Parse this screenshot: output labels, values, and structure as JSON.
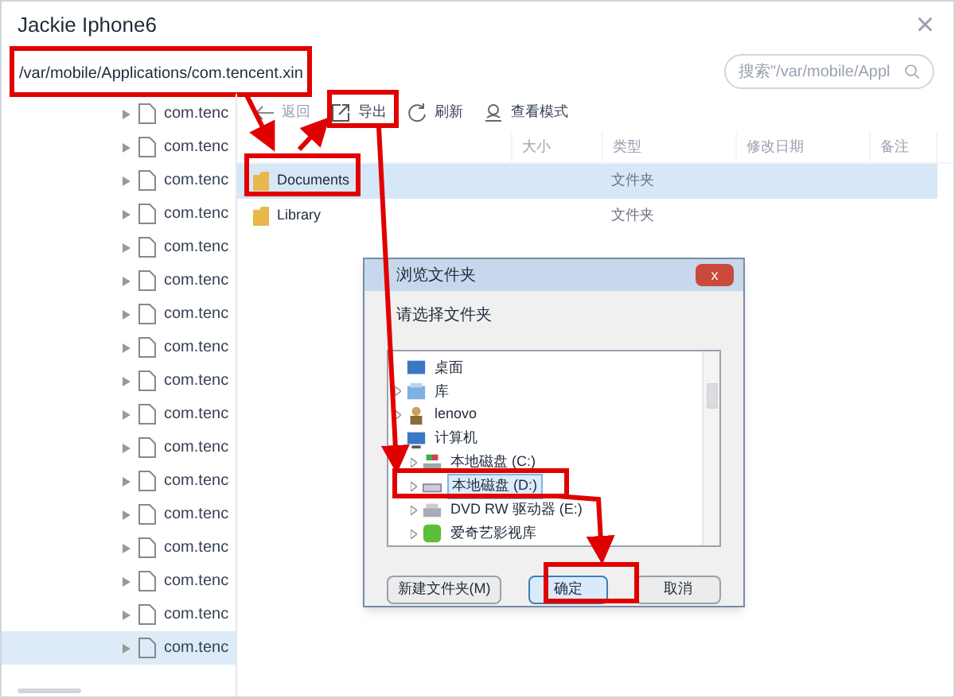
{
  "window": {
    "title": "Jackie Iphone6",
    "close": "×"
  },
  "path": "/var/mobile/Applications/com.tencent.xin",
  "search": {
    "placeholder": "搜索\"/var/mobile/Appl"
  },
  "tree": [
    {
      "label": "com.tenc",
      "selected": false
    },
    {
      "label": "com.tenc",
      "selected": false
    },
    {
      "label": "com.tenc",
      "selected": false
    },
    {
      "label": "com.tenc",
      "selected": false
    },
    {
      "label": "com.tenc",
      "selected": false
    },
    {
      "label": "com.tenc",
      "selected": false
    },
    {
      "label": "com.tenc",
      "selected": false
    },
    {
      "label": "com.tenc",
      "selected": false
    },
    {
      "label": "com.tenc",
      "selected": false
    },
    {
      "label": "com.tenc",
      "selected": false
    },
    {
      "label": "com.tenc",
      "selected": false
    },
    {
      "label": "com.tenc",
      "selected": false
    },
    {
      "label": "com.tenc",
      "selected": false
    },
    {
      "label": "com.tenc",
      "selected": false
    },
    {
      "label": "com.tenc",
      "selected": false
    },
    {
      "label": "com.tenc",
      "selected": false
    },
    {
      "label": "com.tenc",
      "selected": true
    }
  ],
  "toolbar": [
    {
      "kind": "back",
      "label": "返回"
    },
    {
      "kind": "export",
      "label": "导出"
    },
    {
      "kind": "refresh",
      "label": "刷新"
    },
    {
      "kind": "view",
      "label": "查看模式"
    }
  ],
  "table": {
    "columns": [
      "大小",
      "类型",
      "修改日期",
      "备注"
    ],
    "rows": [
      {
        "name": "Documents",
        "type": "文件夹",
        "selected": true
      },
      {
        "name": "Library",
        "type": "文件夹",
        "selected": false
      }
    ]
  },
  "dialog": {
    "title": "浏览文件夹",
    "close": "x",
    "prompt": "请选择文件夹",
    "items": [
      {
        "label": "桌面",
        "kind": "desktop",
        "expandable": false,
        "selected": false
      },
      {
        "label": "库",
        "kind": "library",
        "expandable": true,
        "selected": false
      },
      {
        "label": "lenovo",
        "kind": "user",
        "expandable": true,
        "selected": false
      },
      {
        "label": "计算机",
        "kind": "computer",
        "expandable": false,
        "selected": false
      },
      {
        "label": "本地磁盘 (C:)",
        "kind": "sysdrive",
        "expandable": true,
        "selected": false
      },
      {
        "label": "本地磁盘 (D:)",
        "kind": "drive",
        "expandable": true,
        "selected": true
      },
      {
        "label": "DVD RW 驱动器 (E:)",
        "kind": "dvd",
        "expandable": true,
        "selected": false
      },
      {
        "label": "爱奇艺影视库",
        "kind": "app",
        "expandable": true,
        "selected": false
      }
    ],
    "buttons": [
      {
        "label": "新建文件夹(M)",
        "primary": false
      },
      {
        "label": "确定",
        "primary": true
      },
      {
        "label": "取消",
        "primary": false
      }
    ]
  }
}
